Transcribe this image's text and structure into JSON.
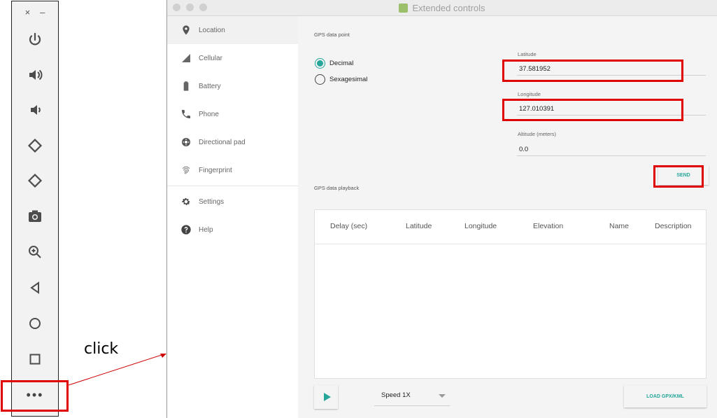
{
  "toolbar": {
    "close": "×",
    "minimize": "–",
    "more": "•••"
  },
  "annotation": {
    "click_label": "click"
  },
  "window": {
    "title": "Extended controls"
  },
  "nav": {
    "items": [
      {
        "label": "Location",
        "icon": "location-pin-icon"
      },
      {
        "label": "Cellular",
        "icon": "signal-icon"
      },
      {
        "label": "Battery",
        "icon": "battery-icon"
      },
      {
        "label": "Phone",
        "icon": "phone-icon"
      },
      {
        "label": "Directional pad",
        "icon": "dpad-icon"
      },
      {
        "label": "Fingerprint",
        "icon": "fingerprint-icon"
      },
      {
        "label": "Settings",
        "icon": "gear-icon"
      },
      {
        "label": "Help",
        "icon": "help-icon"
      }
    ]
  },
  "gps": {
    "point_label": "GPS data point",
    "format_decimal": "Decimal",
    "format_sexagesimal": "Sexagesimal",
    "latitude_label": "Latitude",
    "latitude_value": "37.581952",
    "longitude_label": "Longitude",
    "longitude_value": "127.010391",
    "altitude_label": "Altitude (meters)",
    "altitude_value": "0.0",
    "send_label": "SEND",
    "playback_label": "GPS data playback",
    "columns": [
      "Delay (sec)",
      "Latitude",
      "Longitude",
      "Elevation",
      "Name",
      "Description"
    ],
    "speed_value": "Speed 1X",
    "load_label": "LOAD GPX/KML"
  },
  "colors": {
    "accent": "#26a69a",
    "highlight": "#e10000"
  }
}
